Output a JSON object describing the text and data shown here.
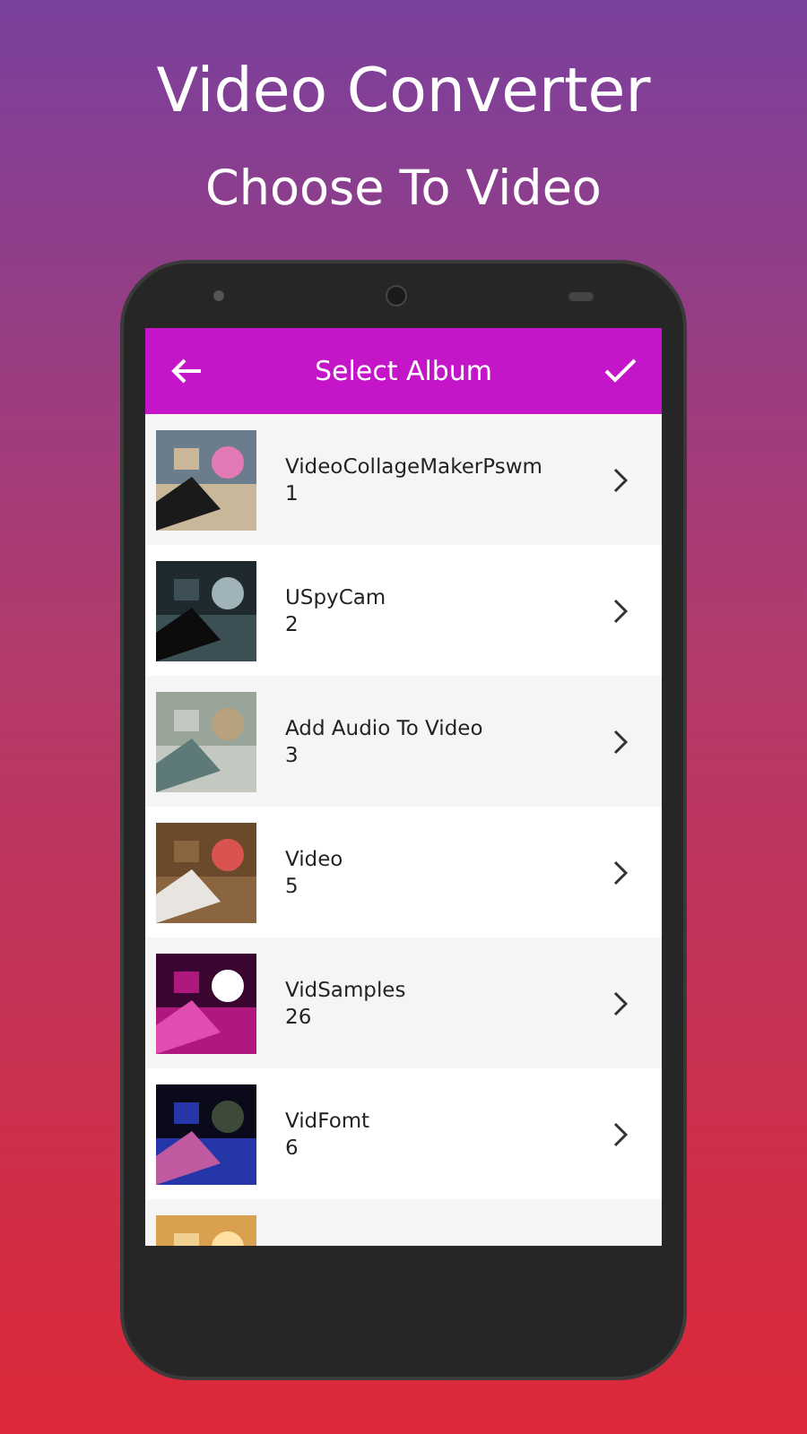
{
  "headline": "Video Converter",
  "subheadline": "Choose To Video",
  "app_bar": {
    "title": "Select Album"
  },
  "albums": [
    {
      "kind": "album",
      "name": "VideoCollageMakerPswm",
      "count": "1"
    },
    {
      "kind": "album",
      "name": "USpyCam",
      "count": "2"
    },
    {
      "kind": "album",
      "name": "Add Audio To Video",
      "count": "3"
    },
    {
      "kind": "album",
      "name": "Video",
      "count": "5"
    },
    {
      "kind": "album",
      "name": "VidSamples",
      "count": "26"
    },
    {
      "kind": "album",
      "name": "VidFomt",
      "count": "6"
    },
    {
      "kind": "picture"
    }
  ]
}
